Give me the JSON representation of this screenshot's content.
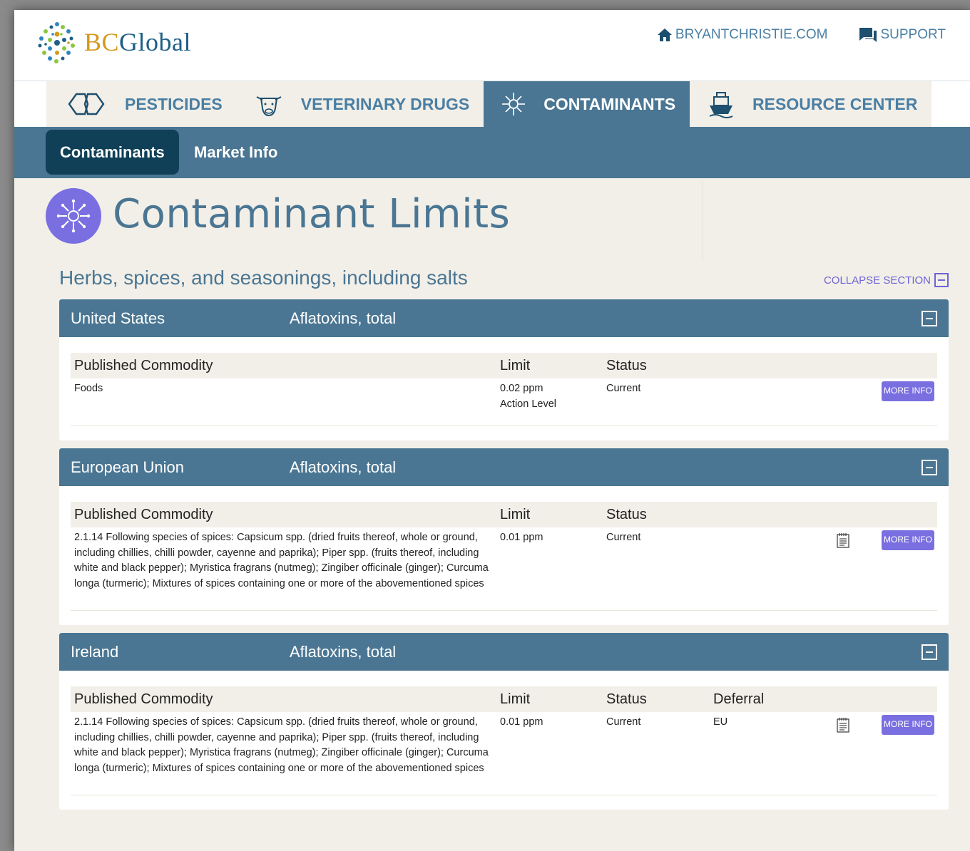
{
  "brand": {
    "part1": "BC",
    "part2": "Global"
  },
  "toplinks": {
    "site": "BRYANTCHRISTIE.COM",
    "support": "SUPPORT"
  },
  "nav": {
    "tabs": [
      {
        "label": "PESTICIDES",
        "icon": "pesticides-icon"
      },
      {
        "label": "VETERINARY DRUGS",
        "icon": "cow-icon"
      },
      {
        "label": "CONTAMINANTS",
        "icon": "contaminant-icon",
        "active": true
      },
      {
        "label": "RESOURCE CENTER",
        "icon": "ship-icon"
      }
    ]
  },
  "subnav": {
    "items": [
      "Contaminants",
      "Market Info"
    ],
    "active": "Contaminants"
  },
  "page": {
    "title": "Contaminant Limits"
  },
  "section": {
    "title": "Herbs, spices, and seasonings, including salts",
    "collapse_label": "COLLAPSE SECTION"
  },
  "table_headers": {
    "commodity": "Published Commodity",
    "limit": "Limit",
    "status": "Status",
    "deferral": "Deferral"
  },
  "more_info_label": "MORE INFO",
  "cards": [
    {
      "country": "United States",
      "contaminant": "Aflatoxins, total",
      "row": {
        "commodity": "Foods",
        "limit": "0.02 ppm",
        "limit_note": "Action Level",
        "status": "Current",
        "deferral": ""
      }
    },
    {
      "country": "European Union",
      "contaminant": "Aflatoxins, total",
      "row": {
        "commodity": "2.1.14 Following species of spices: Capsicum spp. (dried fruits thereof, whole or ground, including chillies, chilli powder, cayenne and paprika); Piper spp. (fruits thereof, including white and black pepper); Myristica fragrans (nutmeg); Zingiber officinale (ginger); Curcuma longa (turmeric); Mixtures of spices containing one or more of the abovementioned spices",
        "limit": "0.01 ppm",
        "limit_note": "",
        "status": "Current",
        "deferral": ""
      }
    },
    {
      "country": "Ireland",
      "contaminant": "Aflatoxins, total",
      "row": {
        "commodity": "2.1.14 Following species of spices: Capsicum spp. (dried fruits thereof, whole or ground, including chillies, chilli powder, cayenne and paprika); Piper spp. (fruits thereof, including white and black pepper); Myristica fragrans (nutmeg); Zingiber officinale (ginger); Curcuma longa (turmeric); Mixtures of spices containing one or more of the abovementioned spices",
        "limit": "0.01 ppm",
        "limit_note": "",
        "status": "Current",
        "deferral": "EU"
      }
    }
  ],
  "colors": {
    "header_blue": "#4a7693",
    "active_subtab": "#0f4057",
    "accent_purple": "#7a6fe0",
    "link_blue": "#4a7fa4",
    "page_bg": "#f2efe8"
  }
}
